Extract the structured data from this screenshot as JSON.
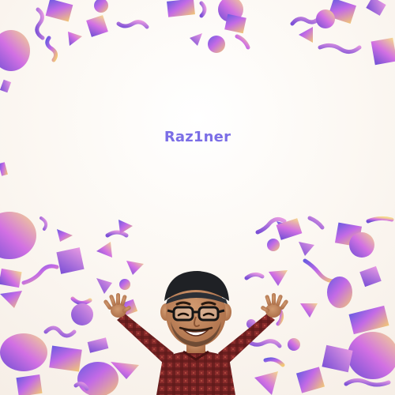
{
  "screen": {
    "title": "Raz1ner",
    "title_color": "#7b6ee6",
    "background_color": "#fbf6f0"
  },
  "confetti": {
    "colors": [
      "#7a4fd6",
      "#b25ee8",
      "#d873e6",
      "#efb451",
      "#f3d78b",
      "#6a5be0"
    ]
  },
  "avatar": {
    "icon": "memoji-celebrating-avatar",
    "shirt_color": "#8a2b2b",
    "cap_color": "#1f2125",
    "skin_color": "#b57a52"
  }
}
